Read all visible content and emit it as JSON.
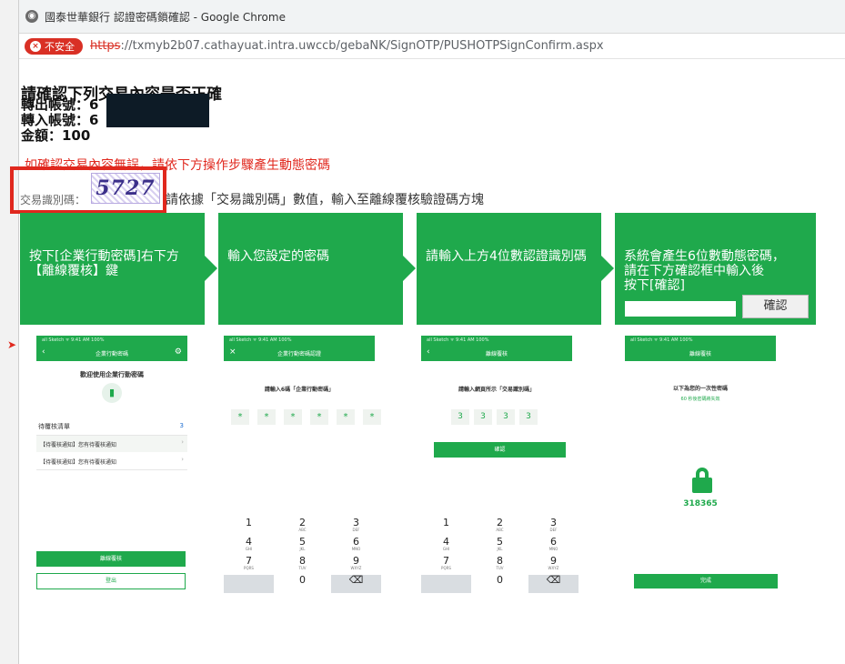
{
  "window": {
    "title": "國泰世華銀行 認證密碼鎖確認 - Google Chrome"
  },
  "address": {
    "insecure_label": "不安全",
    "scheme": "https",
    "rest": "://txmyb2b07.cathayuat.intra.uwccb/gebaNK/SignOTP/PUSHOTPSignConfirm.aspx"
  },
  "confirm": {
    "heading": "請確認下列交易內容是否正確",
    "out_account": "轉出帳號：6",
    "in_account": "轉入帳號：6",
    "amount": "金額：100",
    "warning": "如確認交易內容無誤，請依下方操作步驟產生動態密碼",
    "captcha_label": "交易識別碼：",
    "captcha_text": "5727",
    "instruction": "請依據「交易識別碼」數值，輸入至離線覆核驗證碼方塊"
  },
  "steps": [
    {
      "text_lines": [
        "按下[企業行動密碼]右下方",
        "【離線覆核】鍵"
      ]
    },
    {
      "text_lines": [
        "輸入您設定的密碼"
      ]
    },
    {
      "text_lines": [
        "請輸入上方4位數認證識別碼"
      ]
    },
    {
      "text_lines": [
        "系統會產生6位數動態密碼，",
        "請在下方確認框中輸入後",
        "按下[確認]"
      ],
      "confirm_button": "確認"
    }
  ],
  "phones": {
    "p1": {
      "status": "all Sketch ᯤ      9:41 AM      100%",
      "title": "企業行動密碼",
      "welcome": "歡迎使用企業行動密碼",
      "list_header": "待覆核清單",
      "list_count": "3",
      "row1": "【待覆核通知】您有待覆核通知",
      "row2": "【待覆核通知】您有待覆核通知",
      "btn_offline": "離線覆核",
      "btn_logout": "登出"
    },
    "p2": {
      "status": "all Sketch ᯤ      9:41 AM      100%",
      "title": "企業行動密碼認證",
      "prompt": "請輸入6碼「企業行動密碼」",
      "star": "*"
    },
    "p3": {
      "status": "all Sketch ᯤ      9:41 AM      100%",
      "title": "離線覆核",
      "prompt": "請輸入網頁所示「交易識別碼」",
      "digits": [
        "3",
        "3",
        "3",
        "3"
      ],
      "btn": "確認"
    },
    "p4": {
      "status": "all Sketch ᯤ      9:41 AM      100%",
      "title": "離線覆核",
      "prompt": "以下為您的一次性密碼",
      "sub": "60 秒後密碼將失效",
      "otp": "318365",
      "btn": "完成"
    }
  },
  "keypad": {
    "keys": [
      {
        "n": "1",
        "s": ""
      },
      {
        "n": "2",
        "s": "ABC"
      },
      {
        "n": "3",
        "s": "DEF"
      },
      {
        "n": "4",
        "s": "GHI"
      },
      {
        "n": "5",
        "s": "JKL"
      },
      {
        "n": "6",
        "s": "MNO"
      },
      {
        "n": "7",
        "s": "PQRS"
      },
      {
        "n": "8",
        "s": "TUV"
      },
      {
        "n": "9",
        "s": "WXYZ"
      },
      {
        "n": "",
        "s": ""
      },
      {
        "n": "0",
        "s": ""
      },
      {
        "n": "⌫",
        "s": ""
      }
    ]
  },
  "colors": {
    "green": "#1fa94c",
    "red": "#e0281e"
  }
}
